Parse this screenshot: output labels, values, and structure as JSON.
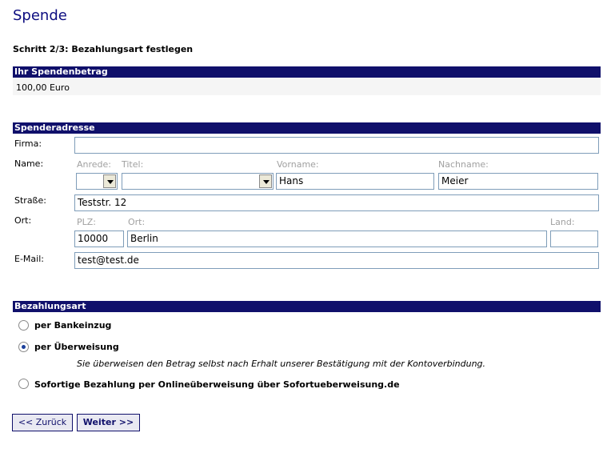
{
  "page": {
    "title": "Spende",
    "step": "Schritt 2/3: Bezahlungsart festlegen"
  },
  "amount": {
    "header": "Ihr Spendenbetrag",
    "value": "100,00 Euro"
  },
  "address": {
    "header": "Spenderadresse",
    "firma_label": "Firma:",
    "firma_value": "",
    "name_label": "Name:",
    "anrede_label": "Anrede:",
    "anrede_value": "",
    "titel_label": "Titel:",
    "titel_value": "",
    "vorname_label": "Vorname:",
    "vorname_value": "Hans",
    "nachname_label": "Nachname:",
    "nachname_value": "Meier",
    "strasse_label": "Straße:",
    "strasse_value": "Teststr. 12",
    "ort_label": "Ort:",
    "plz_label": "PLZ:",
    "plz_value": "10000",
    "ort_sub_label": "Ort:",
    "ort_value": "Berlin",
    "land_label": "Land:",
    "land_value": "",
    "email_label": "E-Mail:",
    "email_value": "test@test.de"
  },
  "payment": {
    "header": "Bezahlungsart",
    "options": [
      {
        "label": "per Bankeinzug",
        "selected": false
      },
      {
        "label": "per Überweisung",
        "selected": true
      },
      {
        "label": "Sofortige Bezahlung per Onlineüberweisung über Sofortueberweisung.de",
        "selected": false
      }
    ],
    "hint": "Sie überweisen den Betrag selbst nach Erhalt unserer Bestätigung mit der Kontoverbindung."
  },
  "buttons": {
    "back": "<< Zurück",
    "next": "Weiter >>"
  }
}
